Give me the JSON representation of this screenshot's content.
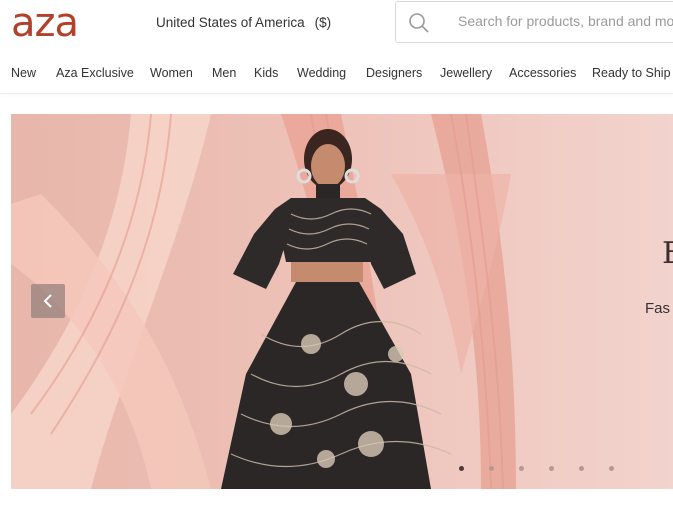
{
  "header": {
    "logo": "aza",
    "country": "United States of America",
    "currency": "($)",
    "search_placeholder": "Search for products, brand and more",
    "search_value": ""
  },
  "nav": [
    "New",
    "Aza Exclusive",
    "Women",
    "Men",
    "Kids",
    "Wedding",
    "Designers",
    "Jewellery",
    "Accessories",
    "Ready to Ship"
  ],
  "banner": {
    "partial_heading": "E",
    "partial_subtext": "Fas",
    "slide_count": 6,
    "active_slide": 1
  },
  "colors": {
    "brand": "#b3402b",
    "banner_bg": "#e9bcb3"
  }
}
